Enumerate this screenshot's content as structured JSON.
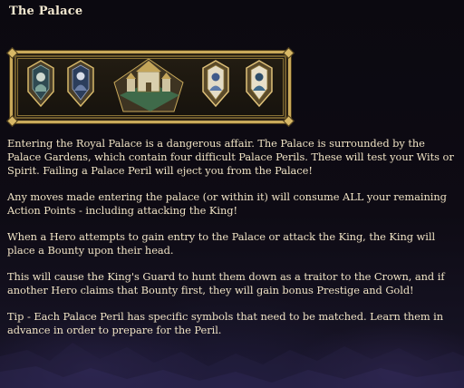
{
  "panel": {
    "title": "The Palace"
  },
  "banner": {
    "icons": [
      "palace-peril-card-1-icon",
      "palace-peril-card-2-icon",
      "royal-palace-icon",
      "palace-peril-card-3-icon",
      "palace-peril-card-4-icon"
    ],
    "accent_color": "#c9a95a"
  },
  "paragraphs": [
    "Entering the Royal Palace is a dangerous affair. The Palace is surrounded by the Palace Gardens, which contain four difficult Palace Perils. These will test your Wits or Spirit. Failing a Palace Peril will eject you from the Palace!",
    "Any moves made entering the palace (or within it) will consume ALL your remaining Action Points - including attacking the King!",
    "When a Hero attempts to gain entry to the Palace or attack the King, the King will place a Bounty upon their head.",
    "This will cause the King's Guard to hunt them down as a traitor to the Crown, and if another Hero claims that Bounty first, they will gain bonus Prestige and Gold!",
    "Tip - Each Palace Peril has specific symbols that need to be matched. Learn them in advance in order to prepare for the Peril."
  ],
  "colors": {
    "text": "#efe2c4",
    "title": "#f1e7cf",
    "background": "#0c0a12"
  }
}
